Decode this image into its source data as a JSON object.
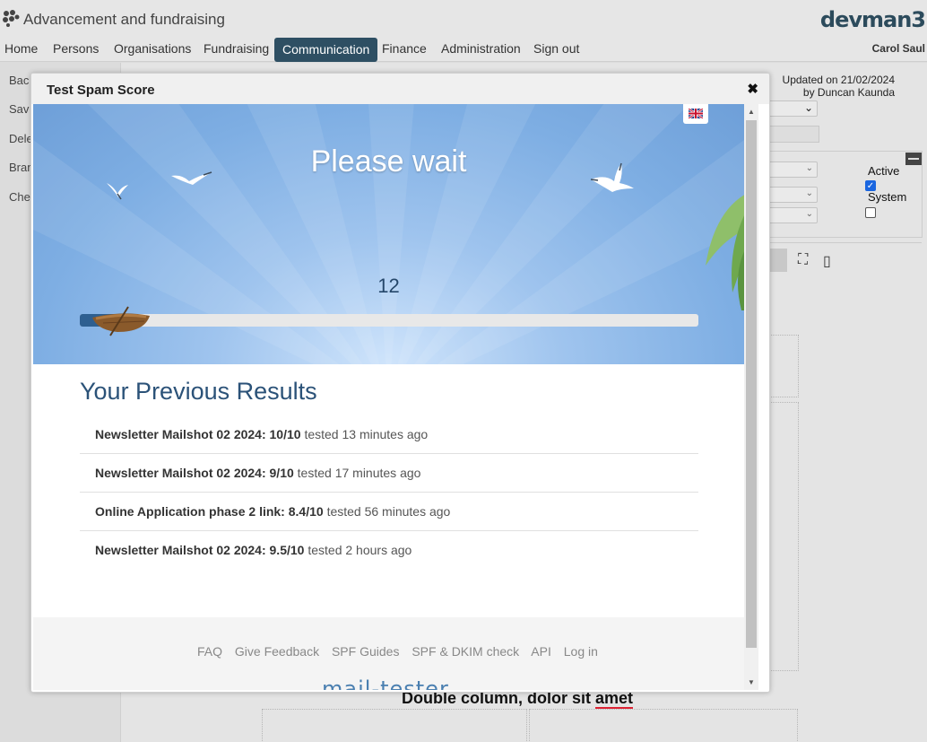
{
  "app": {
    "title": "Advancement and fundraising",
    "brand": "devman3",
    "user": "Carol Saul"
  },
  "nav": {
    "items": [
      {
        "label": "Home"
      },
      {
        "label": "Persons"
      },
      {
        "label": "Organisations"
      },
      {
        "label": "Fundraising"
      },
      {
        "label": "Communication",
        "active": true
      },
      {
        "label": "Finance"
      },
      {
        "label": "Administration"
      },
      {
        "label": "Sign out"
      }
    ]
  },
  "sidebar": {
    "items": [
      {
        "label": "Bac"
      },
      {
        "label": "Sav"
      },
      {
        "label": "Dele"
      },
      {
        "label": "Bran"
      },
      {
        "label": "Che"
      }
    ]
  },
  "background": {
    "updated_line1": "Updated on 21/02/2024",
    "updated_line2": "by Duncan Kaunda",
    "active_label": "Active",
    "active_checked": true,
    "system_label": "System",
    "system_checked": false,
    "content_heading_start": "Double column, dolor sit ",
    "content_heading_end": "amet"
  },
  "modal": {
    "title": "Test Spam Score",
    "close_icon": "close-icon",
    "hero": {
      "wait_text": "Please wait",
      "counter": "12",
      "progress_percent": 6,
      "language_flag": "uk-flag-icon"
    },
    "results_title": "Your Previous Results",
    "results": [
      {
        "name": "Newsletter Mailshot 02 2024: 10/10",
        "tested": "tested 13 minutes ago"
      },
      {
        "name": "Newsletter Mailshot 02 2024: 9/10",
        "tested": "tested 17 minutes ago"
      },
      {
        "name": "Online Application phase 2 link: 8.4/10",
        "tested": "tested 56 minutes ago"
      },
      {
        "name": "Newsletter Mailshot 02 2024: 9.5/10",
        "tested": "tested 2 hours ago"
      }
    ],
    "footer_links": [
      {
        "label": "FAQ"
      },
      {
        "label": "Give Feedback"
      },
      {
        "label": "SPF Guides"
      },
      {
        "label": "SPF & DKIM check"
      },
      {
        "label": "API"
      },
      {
        "label": "Log in"
      }
    ],
    "footer_logo": "mail-tester"
  },
  "colors": {
    "nav_active": "#2e4f63",
    "brand": "#2c4b5c",
    "progress_fill": "#2e5f90",
    "results_title": "#2b5278"
  }
}
